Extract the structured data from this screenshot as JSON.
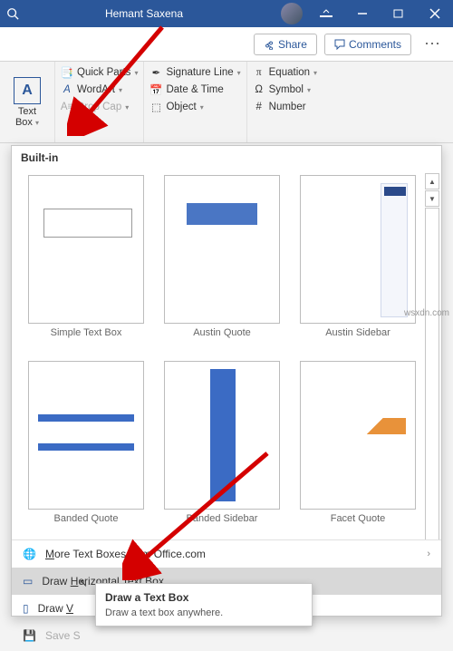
{
  "titlebar": {
    "username": "Hemant Saxena"
  },
  "sharerow": {
    "share": "Share",
    "comments": "Comments"
  },
  "ribbon": {
    "textbox": {
      "line1": "Text",
      "line2": "Box"
    },
    "col1": {
      "quickparts": "Quick Parts",
      "wordart": "WordArt",
      "dropcap": "Drop Cap"
    },
    "col2": {
      "sig": "Signature Line",
      "datetime": "Date & Time",
      "object": "Object"
    },
    "col3": {
      "equation": "Equation",
      "symbol": "Symbol",
      "number": "Number"
    }
  },
  "gallery": {
    "header": "Built-in",
    "items": [
      {
        "label": "Simple Text Box"
      },
      {
        "label": "Austin Quote"
      },
      {
        "label": "Austin Sidebar"
      },
      {
        "label": "Banded Quote"
      },
      {
        "label": "Banded Sidebar"
      },
      {
        "label": "Facet Quote"
      }
    ],
    "footer": {
      "more": "More Text Boxes from Office.com",
      "drawh": "Draw Horizontal Text Box",
      "drawv": "Draw V",
      "save": "Save S"
    }
  },
  "tooltip": {
    "title": "Draw a Text Box",
    "body": "Draw a text box anywhere."
  },
  "watermark": "wsxdn.com"
}
